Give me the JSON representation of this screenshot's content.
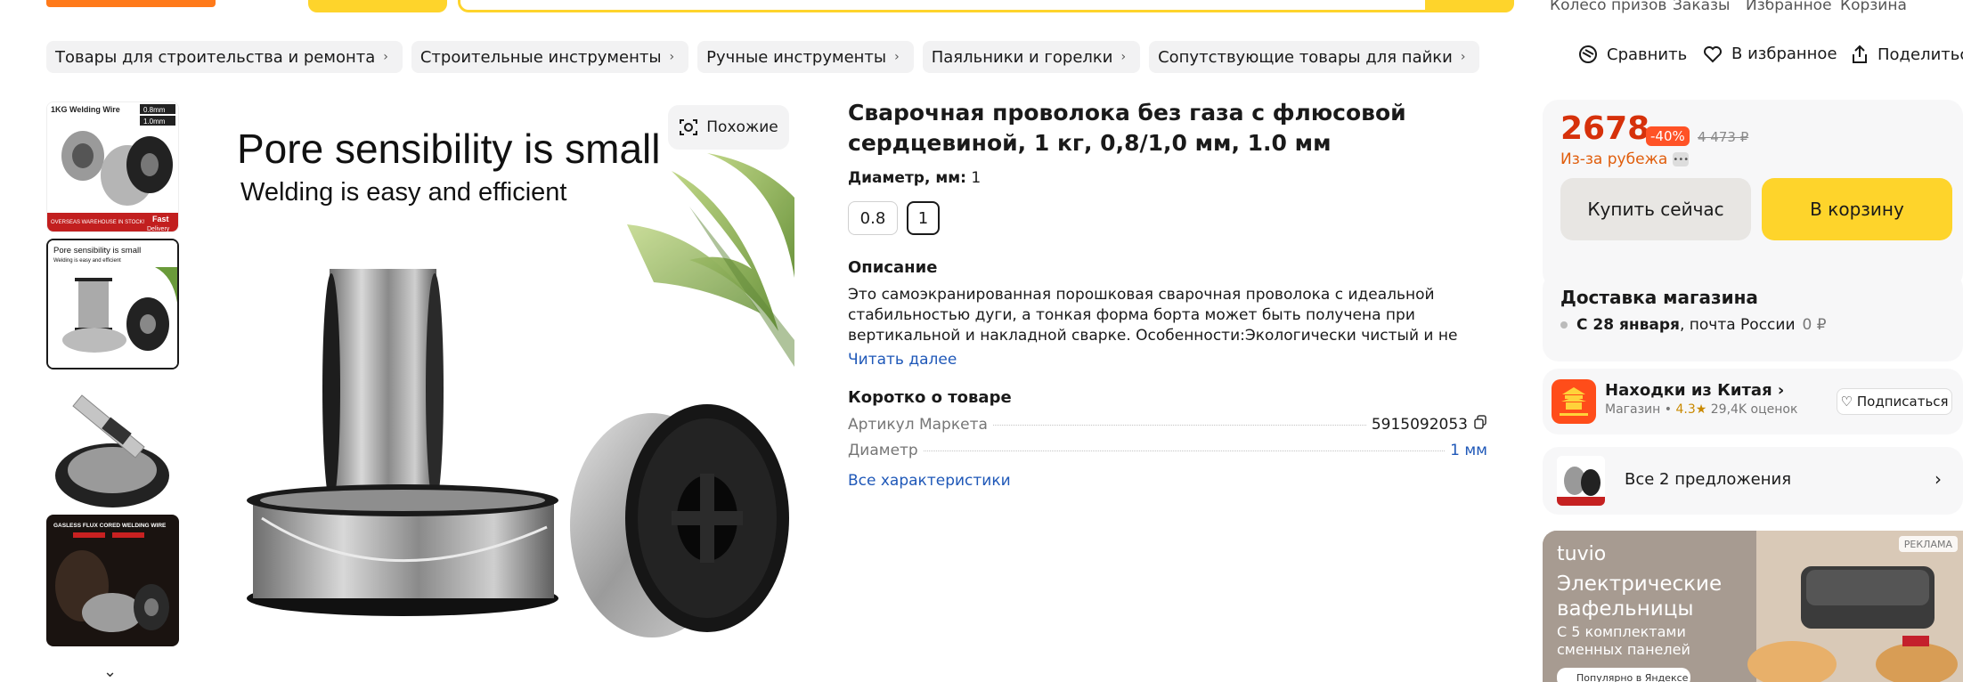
{
  "header": {
    "links": [
      "Колесо призов",
      "Заказы",
      "Избранное",
      "Корзина"
    ]
  },
  "breadcrumbs": [
    "Товары для строительства и ремонта",
    "Строительные инструменты",
    "Ручные инструменты",
    "Паяльники и горелки",
    "Сопутствующие товары для пайки"
  ],
  "actions": {
    "compare": "Сравнить",
    "favorite": "В избранное",
    "share": "Поделиться"
  },
  "gallery": {
    "thumb1": {
      "title": "1KG Welding Wire",
      "badge1": "0.8mm",
      "badge2": "1.0mm",
      "footer": "OVERSEAS WAREHOUSE IN STOCK!",
      "fast": "Fast",
      "delivery": "Delivery"
    },
    "thumb2": {
      "line1": "Pore sensibility is small",
      "line2": "Welding is easy and efficient"
    },
    "thumb4": {
      "title": "GASLESS FLUX CORED WELDING WIRE"
    },
    "main_line1": "Pore sensibility is small",
    "main_line2": "Welding is easy and efficient",
    "similar_label": "Похожие"
  },
  "product": {
    "title": "Сварочная проволока без газа с флюсовой сердцевиной, 1 кг, 0,8/1,0 мм, 1.0 мм",
    "diameter_label": "Диаметр, мм:",
    "diameter_value": "1",
    "options": [
      "0.8",
      "1"
    ],
    "description_heading": "Описание",
    "description": "Это самоэкранированная порошковая сварочная проволока с идеальной стабильностью дуги, а тонкая форма борта может быть получена при вертикальной и накладной сварке. Особенности:Экологически чистый и не вредный. Не окисляется на",
    "read_more": "Читать далее",
    "short_heading": "Коротко о товаре",
    "specs": [
      {
        "key": "Артикул Маркета",
        "value": "5915092053"
      },
      {
        "key": "Диаметр",
        "value": "1 мм"
      }
    ],
    "all_specs": "Все характеристики"
  },
  "buy_box": {
    "price": "2678",
    "currency": "₽",
    "discount": "-40%",
    "old_price": "4 473 ₽",
    "origin": "Из-за рубежа",
    "buy_now": "Купить сейчас",
    "to_cart": "В корзину"
  },
  "delivery": {
    "title": "Доставка магазина",
    "date": "С 28 января",
    "method": ", почта России",
    "cost": "0 ₽"
  },
  "shop": {
    "name": "Находки из Китая",
    "type": "Магазин",
    "rating": "4.3",
    "reviews": "29,4K оценок",
    "subscribe": "Подписаться"
  },
  "offers": {
    "label": "Все 2 предложения"
  },
  "ad": {
    "brand": "tuvio",
    "title_line1": "Электрические",
    "title_line2": "вафельницы",
    "sub_line1": "С 5 комплектами",
    "sub_line2": "сменных панелей",
    "tag": "РЕКЛАМА",
    "pill": "Популярно в Яндексе"
  },
  "colors": {
    "accent_yellow": "#fed42b",
    "price_red": "#d6310b",
    "discount": "#ff5226",
    "link_blue": "#1f58b8"
  }
}
